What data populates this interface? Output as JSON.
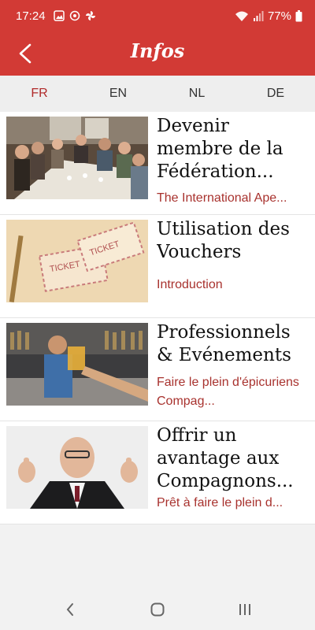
{
  "status": {
    "time": "17:24",
    "battery": "77%"
  },
  "appbar": {
    "title": "Infos"
  },
  "languages": [
    {
      "label": "FR",
      "active": true
    },
    {
      "label": "EN",
      "active": false
    },
    {
      "label": "NL",
      "active": false
    },
    {
      "label": "DE",
      "active": false
    }
  ],
  "articles": [
    {
      "title": "Devenir membre de la Fédération...",
      "subtitle": "The International Ape..."
    },
    {
      "title": "Utilisation des Vouchers",
      "subtitle": "Introduction"
    },
    {
      "title": "Professionnels & Evénements",
      "subtitle": "Faire le plein d'épicuriens Compag..."
    },
    {
      "title": "Offrir un avantage aux Compagnons...",
      "subtitle": "Prêt à faire le plein d..."
    }
  ],
  "colors": {
    "brand": "#d23a35",
    "accent_text": "#a8322e"
  }
}
